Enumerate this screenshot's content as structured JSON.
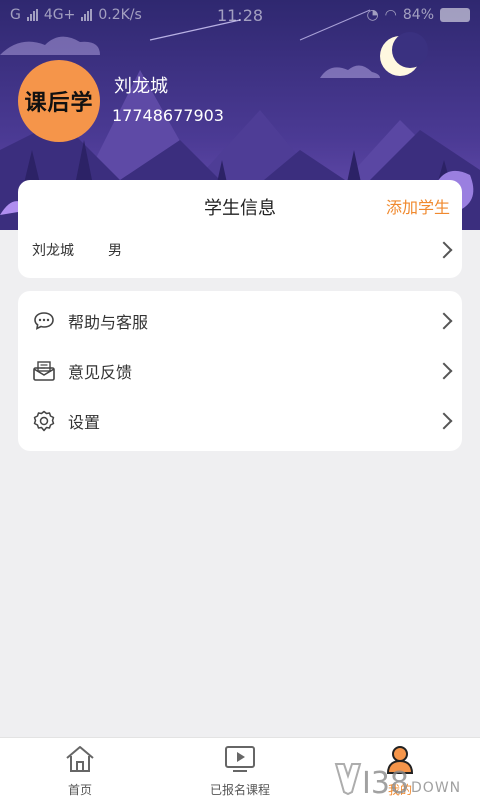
{
  "status_bar": {
    "carrier1": "G",
    "carrier2": "4G+",
    "speed": "0.2K/s",
    "time": "11:28",
    "battery_text": "84%"
  },
  "profile": {
    "logo_text": "课后学",
    "name": "刘龙城",
    "phone": "17748677903"
  },
  "student_card": {
    "title": "学生信息",
    "add_label": "添加学生",
    "student": {
      "name": "刘龙城",
      "gender": "男"
    }
  },
  "menu": {
    "items": [
      {
        "label": "帮助与客服",
        "icon": "chat-bubble-icon"
      },
      {
        "label": "意见反馈",
        "icon": "mail-feedback-icon"
      },
      {
        "label": "设置",
        "icon": "gear-icon"
      }
    ]
  },
  "bottom_nav": {
    "items": [
      {
        "label": "首页",
        "icon": "home-icon"
      },
      {
        "label": "已报名课程",
        "icon": "tv-play-icon"
      },
      {
        "label": "我的",
        "icon": "user-icon"
      }
    ]
  },
  "watermark": {
    "main": "I38",
    "sub": "DOWN"
  },
  "colors": {
    "accent": "#f0892e",
    "logo_bg": "#f5954a",
    "sky_top": "#3a2f7a",
    "sky_bottom": "#6a4fb0",
    "page_bg": "#efeff1"
  }
}
